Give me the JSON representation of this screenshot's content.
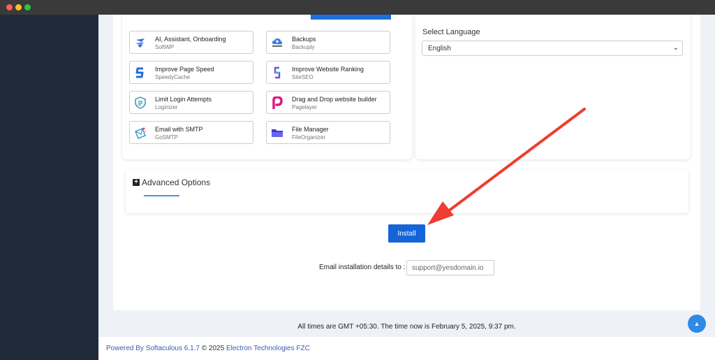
{
  "plugins": [
    {
      "title": "AI, Assistant, Onboarding",
      "sub": "SoftWP",
      "icon": "softwp-icon"
    },
    {
      "title": "Backups",
      "sub": "Backuply",
      "icon": "backuply-icon"
    },
    {
      "title": "Improve Page Speed",
      "sub": "SpeedyCache",
      "icon": "speedycache-icon"
    },
    {
      "title": "Improve Website Ranking",
      "sub": "SiteSEO",
      "icon": "siteseo-icon"
    },
    {
      "title": "Limit Login Attempts",
      "sub": "Loginizer",
      "icon": "loginizer-icon"
    },
    {
      "title": "Drag and Drop website builder",
      "sub": "Pagelayer",
      "icon": "pagelayer-icon"
    },
    {
      "title": "Email with SMTP",
      "sub": "GoSMTP",
      "icon": "gosmtp-icon"
    },
    {
      "title": "File Manager",
      "sub": "FileOrganizer",
      "icon": "fileorganizer-icon"
    }
  ],
  "language": {
    "label": "Select Language",
    "selected": "English"
  },
  "advanced": {
    "label": "Advanced Options"
  },
  "install": {
    "label": "Install"
  },
  "email": {
    "label": "Email installation details to :",
    "value": "support@yesdomain.io"
  },
  "time_text": "All times are GMT +05:30. The time now is February 5, 2025, 9:37 pm.",
  "footer": {
    "powered": "Powered By Softaculous 6.1.7",
    "copyright": " © 2025 ",
    "company": "Electron Technologies FZC"
  },
  "colors": {
    "accent": "#1565d8",
    "sidebar": "#202b3a",
    "arrow": "#f03c32"
  }
}
